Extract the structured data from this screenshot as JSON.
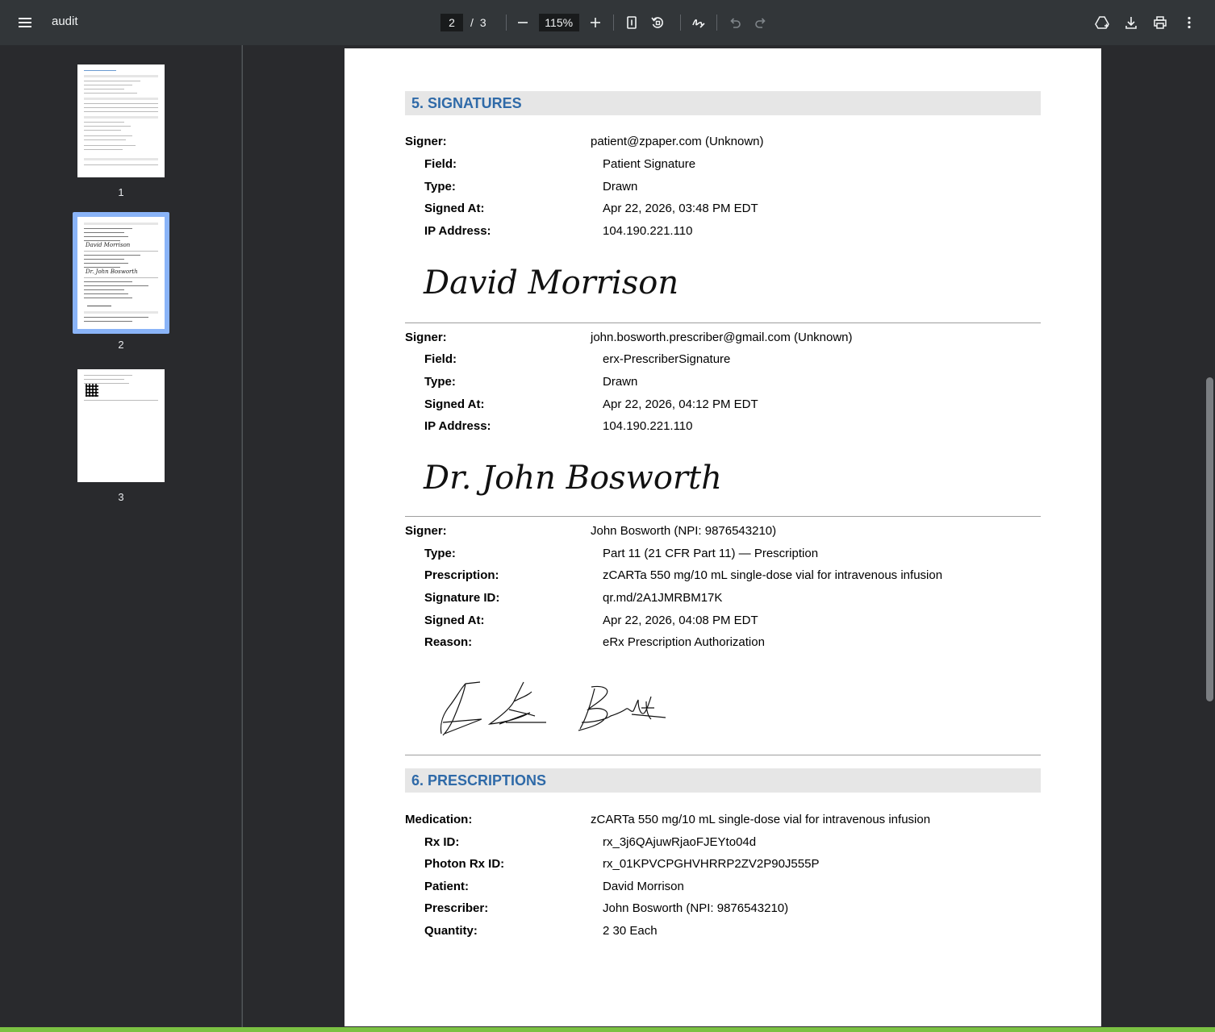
{
  "app": {
    "title": "audit",
    "page_current": "2",
    "page_separator": "/",
    "page_total": "3",
    "zoom": "115%"
  },
  "sidebar": {
    "thumbnails": [
      {
        "label": "1"
      },
      {
        "label": "2"
      },
      {
        "label": "3"
      }
    ]
  },
  "document": {
    "signatures_heading": "5. SIGNATURES",
    "signer1": {
      "signer_label": "Signer:",
      "signer_value": "patient@zpaper.com (Unknown)",
      "field_label": "Field:",
      "field_value": "Patient Signature",
      "type_label": "Type:",
      "type_value": "Drawn",
      "signed_label": "Signed At:",
      "signed_value": "Apr 22, 2026, 03:48 PM EDT",
      "ip_label": "IP Address:",
      "ip_value": "104.190.221.110",
      "signature_image": "David Morrison"
    },
    "signer2": {
      "signer_label": "Signer:",
      "signer_value": "john.bosworth.prescriber@gmail.com (Unknown)",
      "field_label": "Field:",
      "field_value": "erx-PrescriberSignature",
      "type_label": "Type:",
      "type_value": "Drawn",
      "signed_label": "Signed At:",
      "signed_value": "Apr 22, 2026, 04:12 PM EDT",
      "ip_label": "IP Address:",
      "ip_value": "104.190.221.110",
      "signature_image": "Dr. John Bosworth"
    },
    "signer3": {
      "signer_label": "Signer:",
      "signer_value": "John Bosworth (NPI: 9876543210)",
      "type_label": "Type:",
      "type_value": "Part 11 (21 CFR Part 11) — Prescription",
      "rx_label": "Prescription:",
      "rx_value": "zCARTa 550 mg/10 mL single-dose vial for intravenous infusion",
      "sigid_label": "Signature ID:",
      "sigid_value": "qr.md/2A1JMRBM17K",
      "signed_label": "Signed At:",
      "signed_value": "Apr 22, 2026, 04:08 PM EDT",
      "reason_label": "Reason:",
      "reason_value": "eRx Prescription Authorization"
    },
    "prescriptions_heading": "6. PRESCRIPTIONS",
    "prescription": {
      "med_label": "Medication:",
      "med_value": "zCARTa 550 mg/10 mL single-dose vial for intravenous infusion",
      "rxid_label": "Rx ID:",
      "rxid_value": "rx_3j6QAjuwRjaoFJEYto04d",
      "photon_label": "Photon Rx ID:",
      "photon_value": "rx_01KPVCPGHVHRRP2ZV2P90J555P",
      "patient_label": "Patient:",
      "patient_value": "David Morrison",
      "prescriber_label": "Prescriber:",
      "prescriber_value": "John Bosworth (NPI: 9876543210)",
      "qty_label": "Quantity:",
      "qty_value": "2 30 Each"
    }
  }
}
